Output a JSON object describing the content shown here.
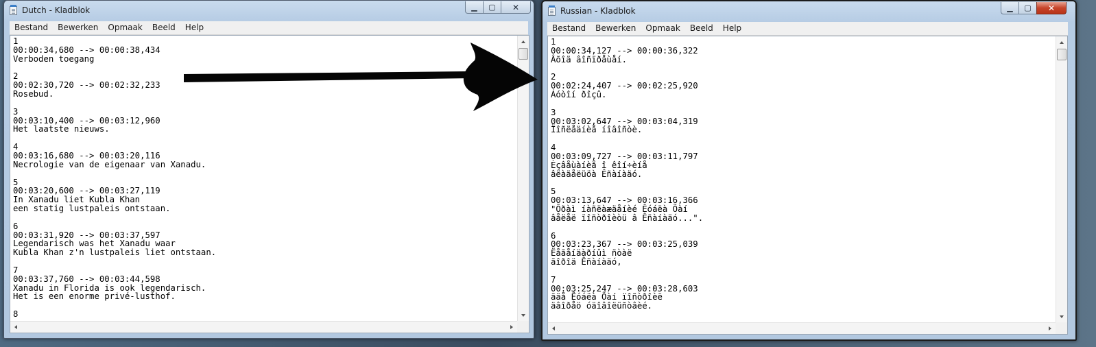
{
  "windows": [
    {
      "title": "Dutch - Kladblok",
      "menu": [
        "Bestand",
        "Bewerken",
        "Opmaak",
        "Beeld",
        "Help"
      ],
      "content": "1\n00:00:34,680 --> 00:00:38,434\nVerboden toegang\n\n2\n00:02:30,720 --> 00:02:32,233\nRosebud.\n\n3\n00:03:10,400 --> 00:03:12,960\nHet laatste nieuws.\n\n4\n00:03:16,680 --> 00:03:20,116\nNecrologie van de eigenaar van Xanadu.\n\n5\n00:03:20,600 --> 00:03:27,119\nIn Xanadu liet Kubla Khan\neen statig lustpaleis ontstaan.\n\n6\n00:03:31,920 --> 00:03:37,597\nLegendarisch was het Xanadu waar\nKubla Khan z'n lustpaleis liet ontstaan.\n\n7\n00:03:37,760 --> 00:03:44,598\nXanadu in Florida is ook legendarisch.\nHet is een enorme privé-lusthof.\n\n8"
    },
    {
      "title": "Russian - Kladblok",
      "menu": [
        "Bestand",
        "Bewerken",
        "Opmaak",
        "Beeld",
        "Help"
      ],
      "content": "1\n00:00:34,127 --> 00:00:36,322\nÂõîä âîñïðåùåí.\n\n2\n00:02:24,407 --> 00:02:25,920\nÁóòîí ðîçû.\n\n3\n00:03:02,647 --> 00:03:04,319\nÏîñëåäíèå íîâîñòè.\n\n4\n00:03:09,727 --> 00:03:11,797\nÈçâåùàíèå î êîí÷èíå\nâëàäåëüöà Êñàíàäó.\n\n5\n00:03:13,647 --> 00:03:16,366\n\"Õðàì íàñëàæäåíèé Êóáëà Õàí\nâåëåë ïîñòðîèòü â Êñàíàäó...\".\n\n6\n00:03:23,367 --> 00:03:25,039\nËåãåíäàðíûì ñòàë\nãîðîä Êñàíàäó,\n\n7\n00:03:25,247 --> 00:03:28,603\nãäå Êóáëà Õàí ïîñòðîèë\näâîðåö óäîâîëüñòâèé."
    }
  ]
}
